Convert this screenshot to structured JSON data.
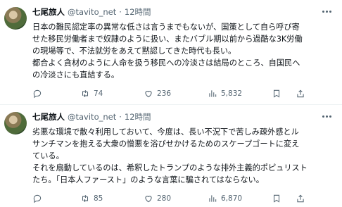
{
  "tweets": [
    {
      "name": "七尾旅人",
      "handle": "@tavito_net",
      "dot": "·",
      "time": "12時間",
      "lines": [
        "日本の難民認定率の異常な低さは言うまでもないが、国策として自ら呼び寄",
        "せた移民労働者まで奴隷のように扱い、またバブル期以前から過酷な3K労働",
        "の現場等で、不法就労をあえて黙認してきた時代も長い。",
        "都合よく貪材のように人命を扱う移民への冷淡さは結局のところ、自国民へ",
        "の冷淡さにも直結する。"
      ],
      "stats": {
        "replies": "",
        "retweets": "74",
        "likes": "236",
        "views": "5,832"
      }
    },
    {
      "name": "七尾旅人",
      "handle": "@tavito_net",
      "dot": "·",
      "time": "12時間",
      "lines": [
        "劣悪な環境で散々利用しておいて、今度は、長い不況下で苦しみ疎外感とル",
        "サンチマンを抱える大衆の憎悪を浴びせかけるためのスケープゴートに変え",
        "ている。",
        "それを扇動しているのは、希釈したトランプのような排外主義的ポピュリスト",
        "たち。「日本人ファースト」のような言葉に騙されてはならない。"
      ],
      "stats": {
        "replies": "",
        "retweets": "85",
        "likes": "280",
        "views": "6,870"
      }
    }
  ],
  "icons": {
    "reply": "reply-icon",
    "retweet": "retweet-icon",
    "like": "heart-icon",
    "views": "views-icon",
    "bookmark": "bookmark-icon",
    "share": "share-icon",
    "more": "more-icon"
  },
  "colors": {
    "text": "#0f1419",
    "muted": "#536471",
    "separator": "#eff3f4"
  }
}
